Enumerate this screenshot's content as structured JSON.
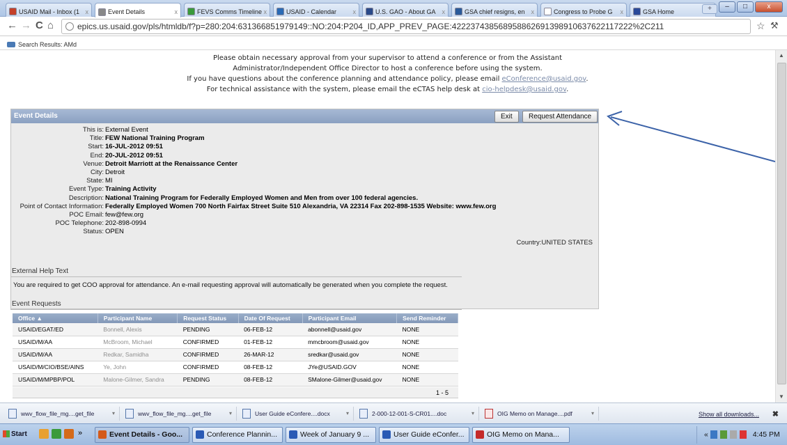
{
  "browser": {
    "tabs": [
      {
        "label": "USAID Mail - Inbox (1",
        "color": "#c4402a",
        "active": false
      },
      {
        "label": "Event Details",
        "color": "#888888",
        "active": true
      },
      {
        "label": "FEVS Comms Timeline",
        "color": "#3a9a3a",
        "active": false
      },
      {
        "label": "USAID - Calendar",
        "color": "#2a6ab5",
        "active": false
      },
      {
        "label": "U.S. GAO - About GA",
        "color": "#2a4a8a",
        "active": false
      },
      {
        "label": "GSA chief resigns, en",
        "color": "#2a5a9a",
        "active": false
      },
      {
        "label": "Congress to Probe G",
        "color": "#ffffff",
        "active": false
      },
      {
        "label": "GSA Home",
        "color": "#2a4a9a",
        "active": false
      }
    ],
    "url": "epics.us.usaid.gov/pls/htmldb/f?p=280:204:631366851979149::NO:204:P204_ID,APP_PREV_PAGE:422237438568958862691398910637622117222%2C211",
    "bookmark": "Search Results: AMd"
  },
  "notice": {
    "line1": "Please obtain approval from your supervisor to attend a conference or from the Assistant",
    "line1_full": "Please obtain necessary approval from your supervisor to attend a conference or from the Assistant",
    "line2": "Administrator/Independent Office Director to host a conference before using the system.",
    "line3_prefix": "If you have questions about the conference planning and attendance policy, please email ",
    "line3_link": "eConference@usaid.gov",
    "line3_suffix": ".",
    "line4_prefix": "For technical assistance with the system, please email the eCTAS help desk at ",
    "line4_link": "cio-helpdesk@usaid.gov",
    "line4_suffix": "."
  },
  "event_details": {
    "header": "Event Details",
    "exit_label": "Exit",
    "request_label": "Request Attendance",
    "country_label": "Country:",
    "country_value": "UNITED STATES",
    "fields": [
      {
        "label": "This is:",
        "value": "External Event",
        "bold": false
      },
      {
        "label": "Title:",
        "value": "FEW National Training Program",
        "bold": true
      },
      {
        "label": "Start:",
        "value": "16-JUL-2012 09:51",
        "bold": true
      },
      {
        "label": "End:",
        "value": "20-JUL-2012 09:51",
        "bold": true
      },
      {
        "label": "Venue:",
        "value": "Detroit Marriott at the Renaissance Center",
        "bold": true
      },
      {
        "label": "City:",
        "value": "Detroit",
        "bold": false
      },
      {
        "label": "State:",
        "value": "MI",
        "bold": false
      },
      {
        "label": "Event Type:",
        "value": "Training Activity",
        "bold": true
      },
      {
        "label": "Description:",
        "value": "National Training Program for Federally Employed Women and Men from over 100 federal agencies.",
        "bold": true
      },
      {
        "label": "Point of Contact Information:",
        "value": "Federally Employed Women 700 North Fairfax Street Suite 510 Alexandria, VA 22314 Fax 202-898-1535 Website: www.few.org",
        "bold": true
      },
      {
        "label": "POC Email:",
        "value": "few@few.org",
        "bold": false
      },
      {
        "label": "POC Telephone:",
        "value": "202-898-0994",
        "bold": false
      },
      {
        "label": "Status:",
        "value": "OPEN",
        "bold": false
      }
    ]
  },
  "help": {
    "title": "External Help Text",
    "text": "You are required to get COO approval for attendance. An e-mail requesting approval will automatically be generated when you complete the request."
  },
  "requests": {
    "title": "Event Requests",
    "columns": [
      "Office ▲",
      "Participant Name",
      "Request Status",
      "Date Of Request",
      "Participant Email",
      "Send Reminder"
    ],
    "rows": [
      [
        "USAID/EGAT/ED",
        "Bonnell, Alexis",
        "PENDING",
        "06-FEB-12",
        "abonnell@usaid.gov",
        "NONE"
      ],
      [
        "USAID/M/AA",
        "McBroom, Michael",
        "CONFIRMED",
        "01-FEB-12",
        "mmcbroom@usaid.gov",
        "NONE"
      ],
      [
        "USAID/M/AA",
        "Redkar, Samidha",
        "CONFIRMED",
        "26-MAR-12",
        "sredkar@usaid.gov",
        "NONE"
      ],
      [
        "USAID/M/CIO/BSE/AINS",
        "Ye, John",
        "CONFIRMED",
        "08-FEB-12",
        "JYe@USAID.GOV",
        "NONE"
      ],
      [
        "USAID/M/MPBP/POL",
        "Malone-Gilmer, Sandra",
        "PENDING",
        "08-FEB-12",
        "SMalone-Gilmer@usaid.gov",
        "NONE"
      ]
    ],
    "pager": "1 - 5"
  },
  "downloads": {
    "items": [
      {
        "label": "wwv_flow_file_mg....get_file",
        "kind": "file"
      },
      {
        "label": "wwv_flow_file_mg....get_file",
        "kind": "file"
      },
      {
        "label": "User Guide eConfere....docx",
        "kind": "doc"
      },
      {
        "label": "2-000-12-001-S-CR01....doc",
        "kind": "doc"
      },
      {
        "label": "OIG Memo on Manage....pdf",
        "kind": "pdf"
      }
    ],
    "show_all": "Show all downloads...",
    "close": "✖"
  },
  "taskbar": {
    "start": "Start",
    "more": "»",
    "windows": [
      {
        "label": "Event Details - Goo...",
        "color": "#d45a1a",
        "active": true
      },
      {
        "label": "Conference Plannin...",
        "color": "#2a5ab5",
        "active": false
      },
      {
        "label": "Week of January 9 ...",
        "color": "#2a5ab5",
        "active": false
      },
      {
        "label": "User Guide eConfer...",
        "color": "#2a5ab5",
        "active": false
      },
      {
        "label": "OIG Memo on Mana...",
        "color": "#c42a2a",
        "active": false
      }
    ],
    "clock": "4:45 PM",
    "tray_prefix": "«"
  }
}
